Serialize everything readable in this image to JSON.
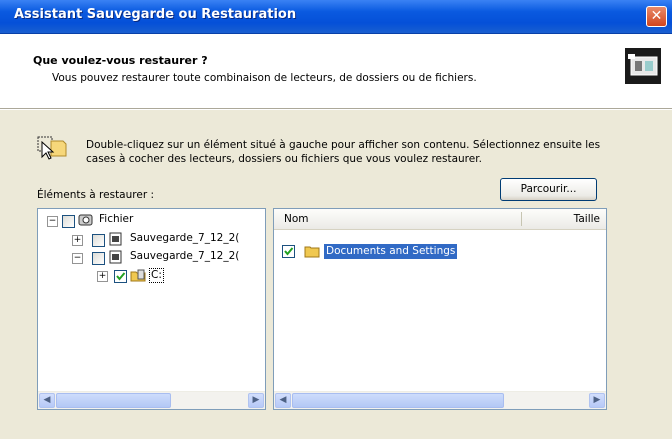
{
  "window": {
    "title": "Assistant Sauvegarde ou Restauration",
    "close_glyph": "✕"
  },
  "header": {
    "title": "Que voulez-vous restaurer ?",
    "subtitle": "Vous pouvez restaurer toute combinaison de lecteurs, de dossiers ou de fichiers.",
    "icon": "backup-restore-icon"
  },
  "hint": {
    "text": "Double-cliquez sur un élément situé à gauche pour afficher son contenu. Sélectionnez ensuite les cases à cocher des lecteurs, dossiers ou fichiers que vous voulez restaurer.",
    "icon": "click-cursor-icon"
  },
  "elements_label": "Éléments à restaurer :",
  "browse_button": "Parcourir...",
  "tree": {
    "items": [
      {
        "label": "Fichier",
        "expanded": true,
        "checked": false
      },
      {
        "label": "Sauvegarde_7_12_2(",
        "expanded": false,
        "checked": false
      },
      {
        "label": "Sauvegarde_7_12_2(",
        "expanded": true,
        "checked": false
      },
      {
        "label": "C:",
        "expanded": false,
        "checked": true
      }
    ]
  },
  "list": {
    "columns": [
      "Nom",
      "Taille"
    ],
    "rows": [
      {
        "name": "Documents and Settings",
        "checked": true,
        "selected": true
      }
    ]
  },
  "colors": {
    "titlebar": "#0a5ae0",
    "selection": "#316ac5",
    "check": "#21a121"
  }
}
